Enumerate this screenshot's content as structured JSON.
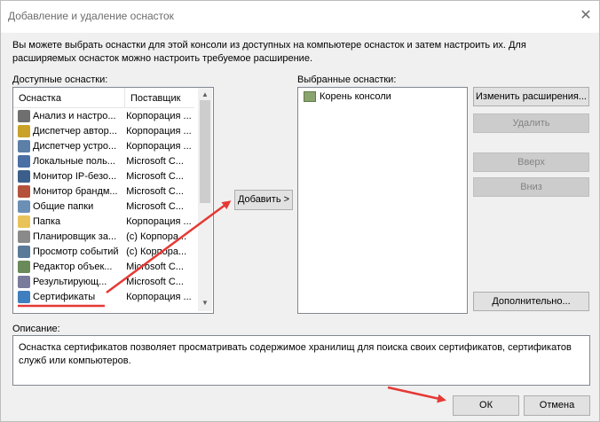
{
  "window": {
    "title": "Добавление и удаление оснасток",
    "close_icon": "close-icon"
  },
  "intro": "Вы можете выбрать оснастки для этой консоли из доступных на компьютере оснасток и затем настроить их. Для расширяемых оснасток можно настроить требуемое расширение.",
  "available": {
    "label": "Доступные оснастки:",
    "columns": [
      "Оснастка",
      "Поставщик"
    ],
    "items": [
      {
        "name": "Анализ и настро...",
        "vendor": "Корпорация ...",
        "icon": "security-config-icon",
        "color": "#6f6f6f"
      },
      {
        "name": "Диспетчер автор...",
        "vendor": "Корпорация ...",
        "icon": "auth-manager-icon",
        "color": "#c9a227"
      },
      {
        "name": "Диспетчер устро...",
        "vendor": "Корпорация ...",
        "icon": "device-manager-icon",
        "color": "#5b7fa6"
      },
      {
        "name": "Локальные поль...",
        "vendor": "Microsoft C...",
        "icon": "users-icon",
        "color": "#4a6fa5"
      },
      {
        "name": "Монитор IP-безо...",
        "vendor": "Microsoft C...",
        "icon": "ip-security-icon",
        "color": "#3b5f8a"
      },
      {
        "name": "Монитор брандм...",
        "vendor": "Microsoft C...",
        "icon": "firewall-icon",
        "color": "#b5523b"
      },
      {
        "name": "Общие папки",
        "vendor": "Microsoft C...",
        "icon": "shared-folders-icon",
        "color": "#6b8fb5"
      },
      {
        "name": "Папка",
        "vendor": "Корпорация ...",
        "icon": "folder-icon",
        "color": "#e8c35a"
      },
      {
        "name": "Планировщик за...",
        "vendor": "(c) Корпора...",
        "icon": "scheduler-icon",
        "color": "#8a8a8a"
      },
      {
        "name": "Просмотр событий",
        "vendor": "(c) Корпора...",
        "icon": "event-viewer-icon",
        "color": "#5a7a9a"
      },
      {
        "name": "Редактор объек...",
        "vendor": "Microsoft C...",
        "icon": "gpo-editor-icon",
        "color": "#6a8a5a"
      },
      {
        "name": "Результирующ...",
        "vendor": "Microsoft C...",
        "icon": "rsop-icon",
        "color": "#7a7a9a"
      },
      {
        "name": "Сертификаты",
        "vendor": "Корпорация ...",
        "icon": "certificates-icon",
        "color": "#3f7fbf"
      }
    ]
  },
  "add_button": "Добавить >",
  "selected": {
    "label": "Выбранные оснастки:",
    "items": [
      {
        "name": "Корень консоли",
        "icon": "folder-icon"
      }
    ]
  },
  "buttons": {
    "edit_extensions": "Изменить расширения...",
    "remove": "Удалить",
    "up": "Вверх",
    "down": "Вниз",
    "advanced": "Дополнительно...",
    "ok": "ОК",
    "cancel": "Отмена"
  },
  "description": {
    "label": "Описание:",
    "text": "Оснастка сертификатов позволяет просматривать содержимое хранилищ для поиска своих сертификатов, сертификатов служб или компьютеров."
  },
  "colors": {
    "annotation": "#e53935"
  }
}
